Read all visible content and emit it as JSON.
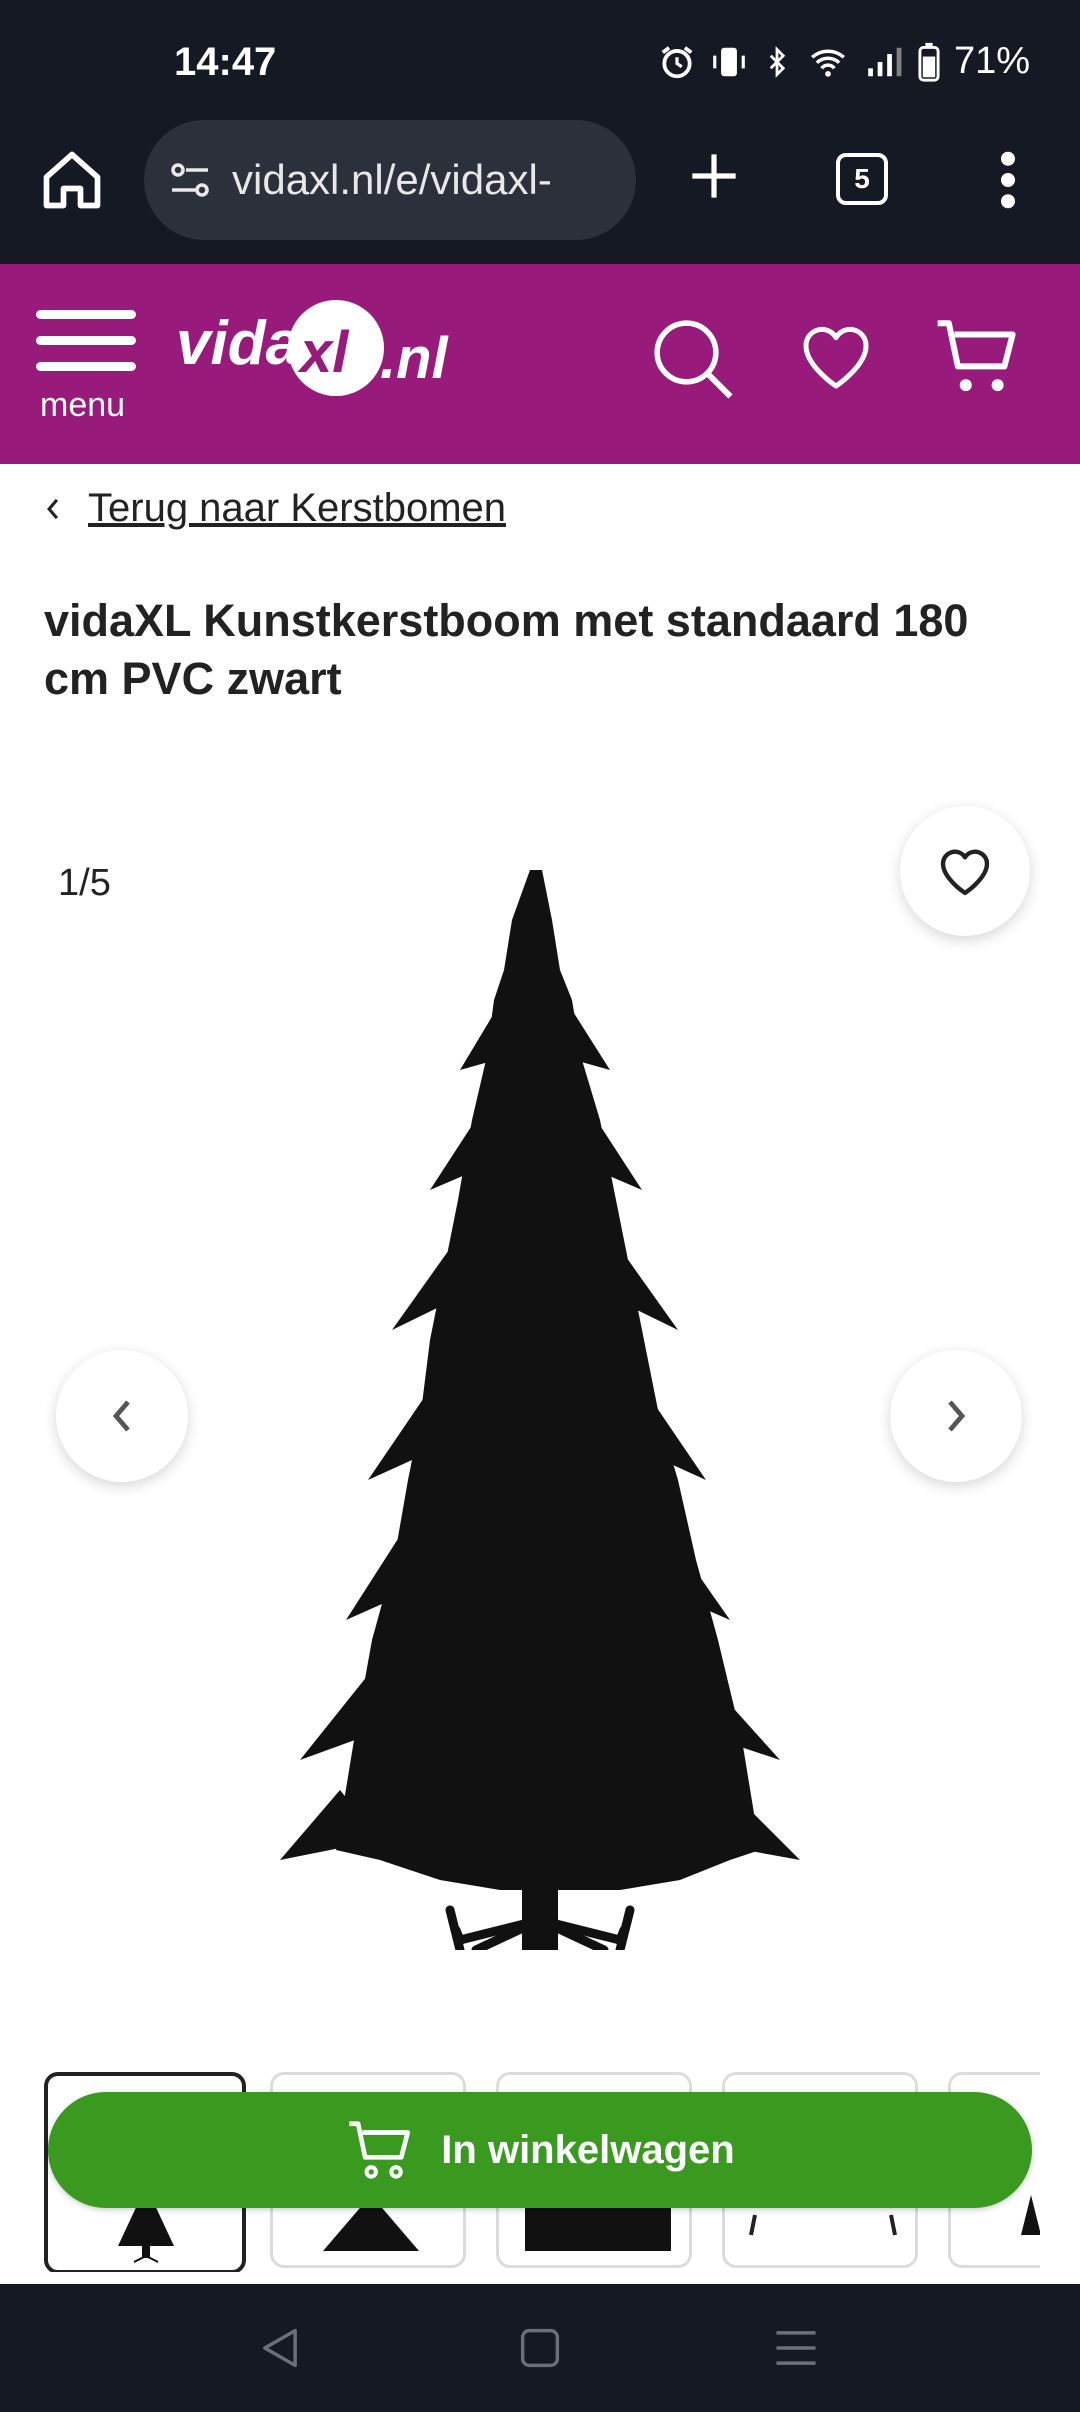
{
  "status_bar": {
    "time": "14:47",
    "battery": "71%",
    "icons": [
      "alarm-icon",
      "vibrate-icon",
      "bluetooth-icon",
      "wifi-icon",
      "signal-icon",
      "battery-icon"
    ]
  },
  "browser": {
    "url": "vidaxl.nl/e/vidaxl-",
    "tab_count": "5"
  },
  "header": {
    "menu_label": "menu",
    "logo_text": "vidaXL.nl",
    "brand_color": "#981b7b"
  },
  "breadcrumb": {
    "back_label": "Terug naar Kerstbomen"
  },
  "product": {
    "title": "vidaXL Kunstkerstboom met standaard 180 cm PVC zwart",
    "image_counter": "1/5"
  },
  "actions": {
    "add_to_cart_label": "In winkelwagen",
    "button_color": "#3a9a1f"
  }
}
